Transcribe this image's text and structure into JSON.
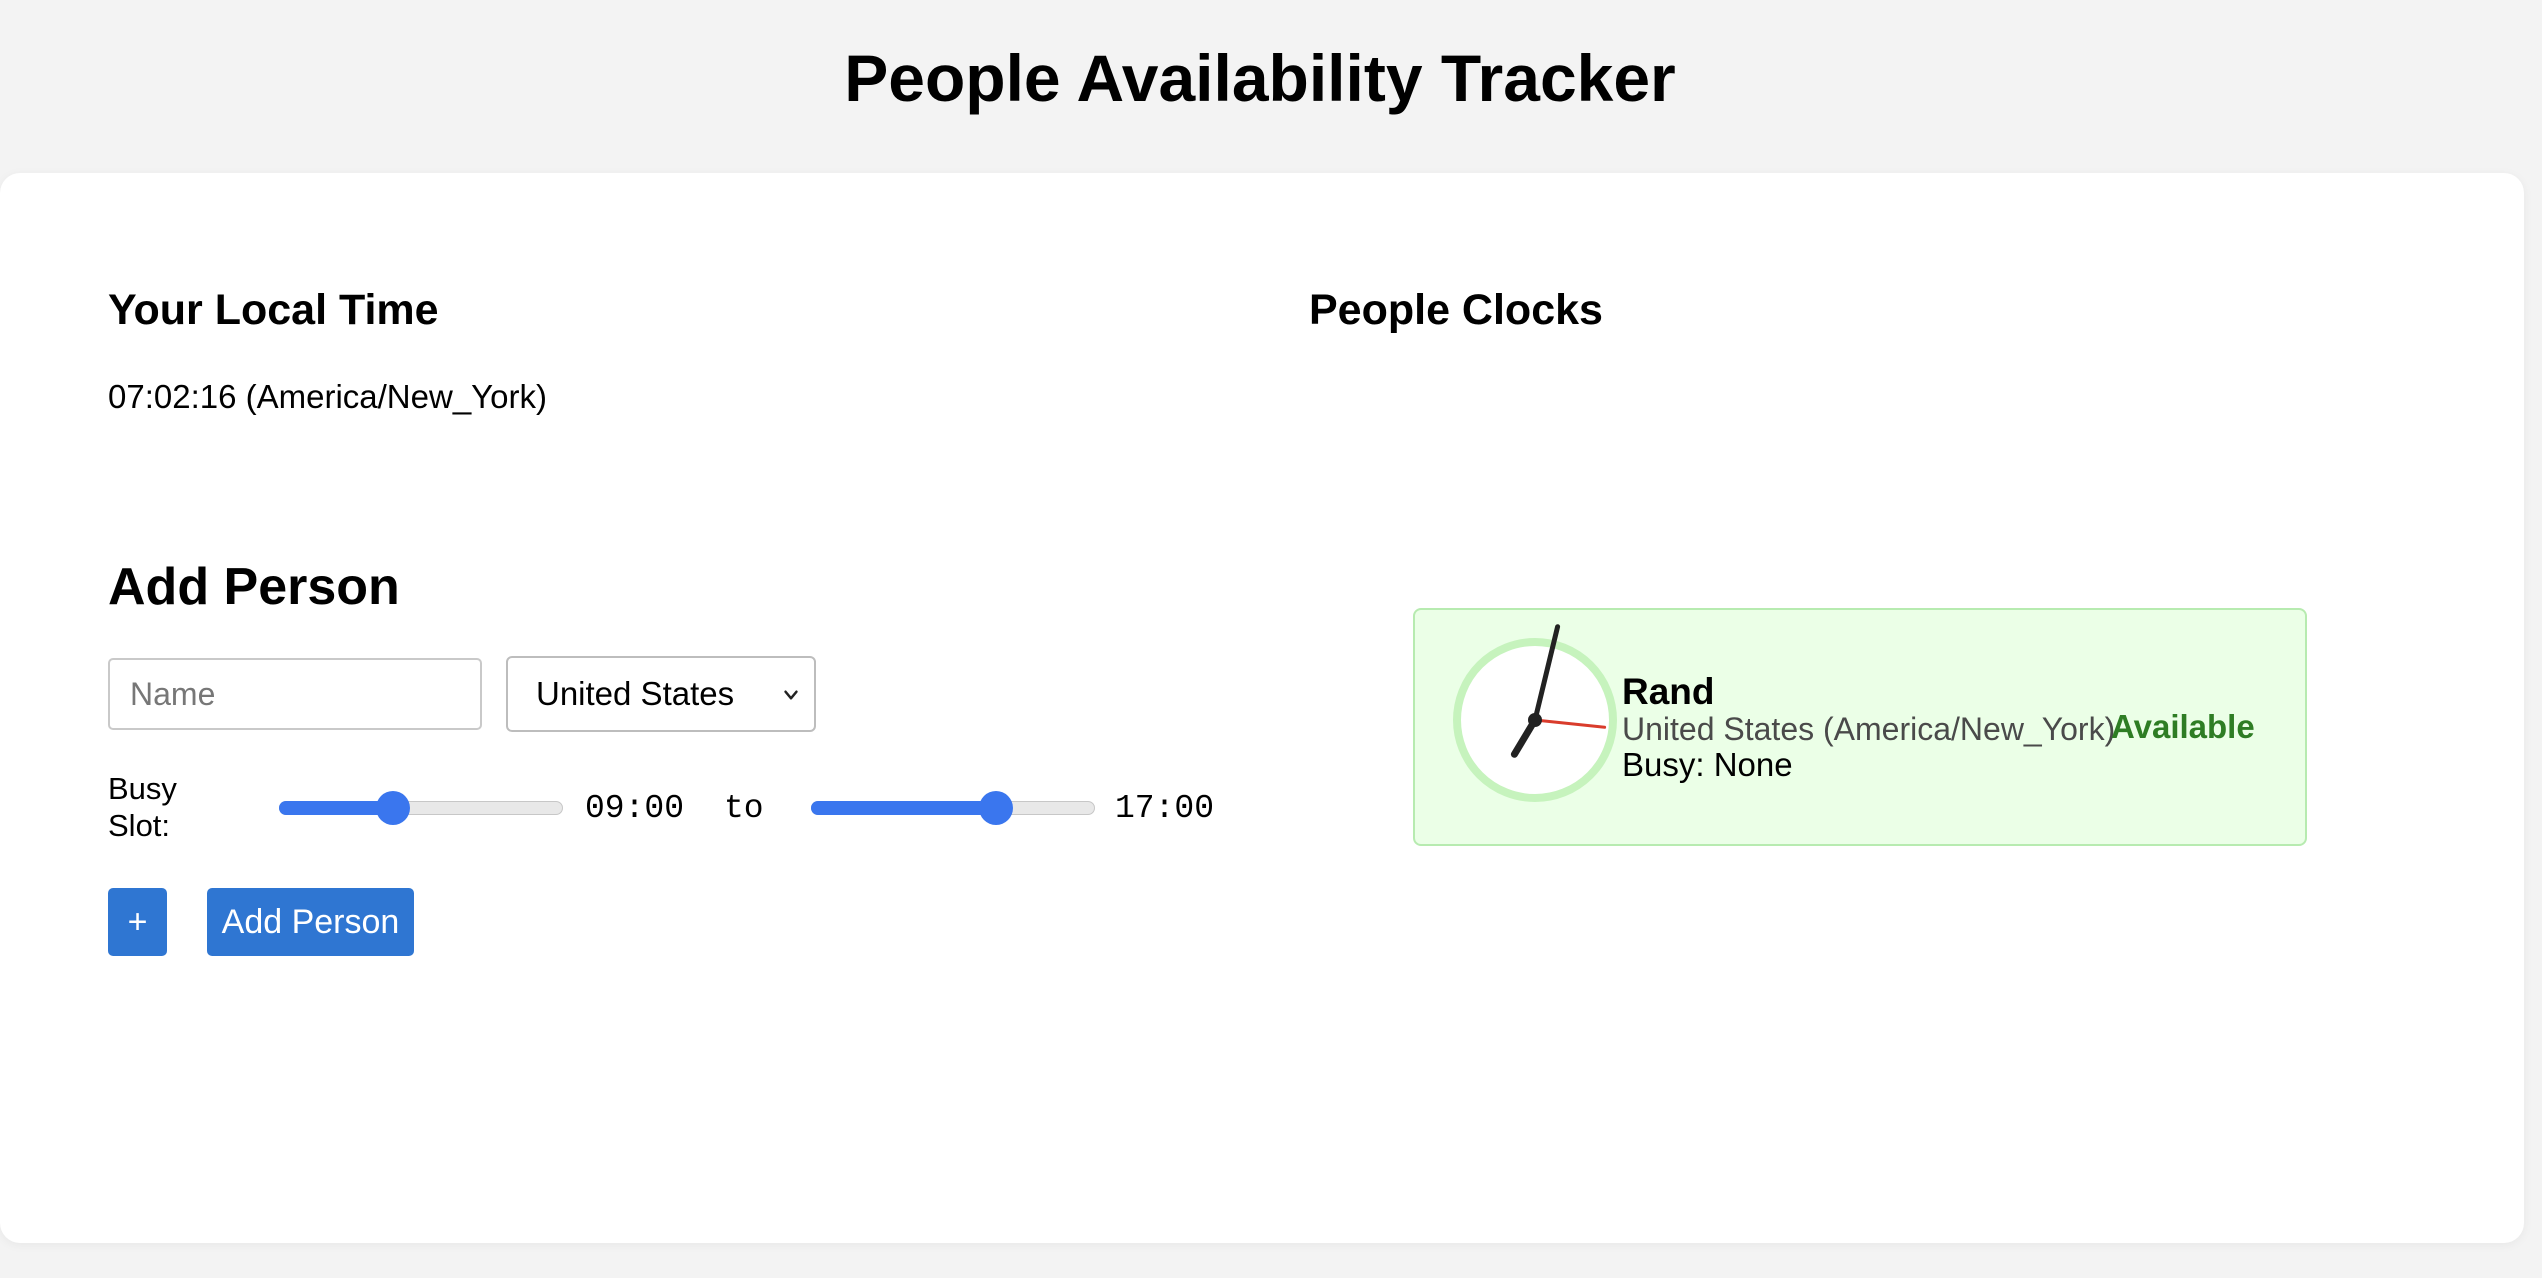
{
  "header": {
    "title": "People Availability Tracker"
  },
  "local_time": {
    "heading": "Your Local Time",
    "value": "07:02:16 (America/New_York)"
  },
  "add_person": {
    "heading": "Add Person",
    "name_placeholder": "Name",
    "name_value": "",
    "country_selected": "United States",
    "busy_label": "Busy Slot:",
    "start_time": "09:00",
    "separator": "to",
    "end_time": "17:00",
    "start_slider_fraction": 0.4,
    "end_slider_fraction": 0.65,
    "plus_label": "+",
    "add_button_label": "Add Person"
  },
  "people_clocks": {
    "heading": "People Clocks",
    "people": [
      {
        "name": "Rand",
        "zone": "United States (America/New_York)",
        "status": "Available",
        "busy": "Busy: None",
        "status_color": "#2e7d24",
        "card_background": "#ebffe7",
        "clock_time": "07:02:16"
      }
    ]
  },
  "colors": {
    "accent": "#2f76d2",
    "slider": "#3a76ee",
    "second_hand": "#d93c2c",
    "clock_ring": "#c6f3bd"
  },
  "icons": {
    "select_arrow": "chevron-down-icon"
  }
}
